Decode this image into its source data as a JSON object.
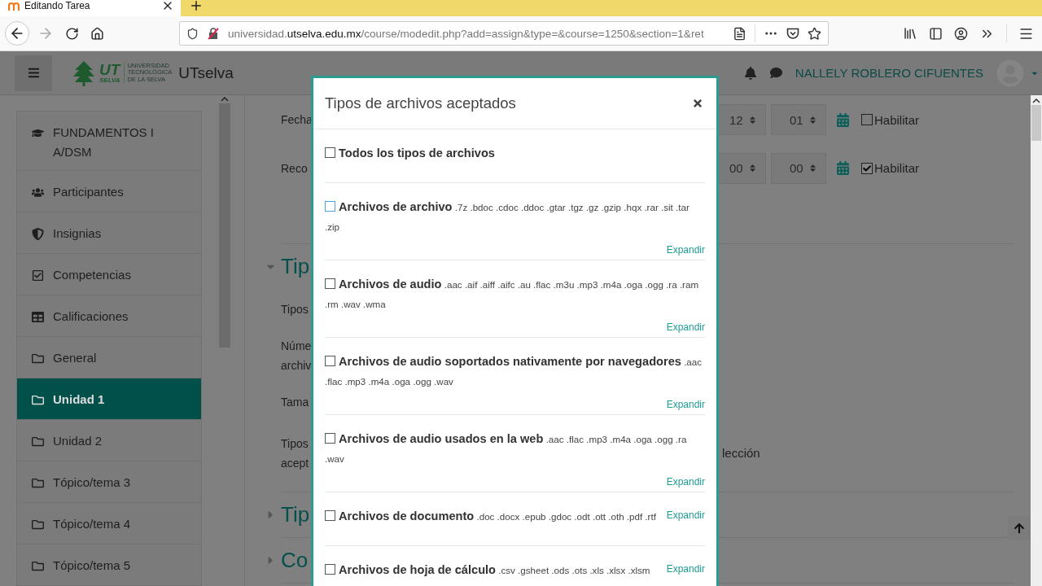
{
  "browser": {
    "tab": {
      "title": "Editando Tarea"
    },
    "url": {
      "prefix": "universidad.",
      "host": "utselva.edu.mx",
      "path": "/course/modedit.php?add=assign&type=&course=1250&section=1&ret"
    }
  },
  "header": {
    "logo": {
      "mark": "UT",
      "sub": "SELVA",
      "lines": [
        "UNIVERSIDAD",
        "TECNOLÓGICA",
        "DE LA SELVA"
      ]
    },
    "site_name": "UTselva",
    "user_name": "NALLELY ROBLERO CIFUENTES"
  },
  "sidebar": {
    "items": [
      {
        "label": "FUNDAMENTOS I A/DSM",
        "kind": "course",
        "selected": false
      },
      {
        "label": "Participantes",
        "kind": "users",
        "selected": false
      },
      {
        "label": "Insignias",
        "kind": "badges",
        "selected": false
      },
      {
        "label": "Competencias",
        "kind": "competencies",
        "selected": false
      },
      {
        "label": "Calificaciones",
        "kind": "grades",
        "selected": false
      },
      {
        "label": "General",
        "kind": "section",
        "selected": false
      },
      {
        "label": "Unidad 1",
        "kind": "section",
        "selected": true
      },
      {
        "label": "Unidad 2",
        "kind": "section",
        "selected": false
      },
      {
        "label": "Tópico/tema 3",
        "kind": "section",
        "selected": false
      },
      {
        "label": "Tópico/tema 4",
        "kind": "section",
        "selected": false
      },
      {
        "label": "Tópico/tema 5",
        "kind": "section",
        "selected": false
      }
    ]
  },
  "main": {
    "rows": [
      {
        "kind": "date",
        "lines": [
          "Fecha"
        ],
        "selects": [
          "12",
          "01"
        ],
        "enable_label": "Habilitar",
        "checked": false
      },
      {
        "kind": "date",
        "lines": [
          "Reco"
        ],
        "selects": [
          "00",
          "00"
        ],
        "enable_label": "Habilitar",
        "checked": true
      },
      {
        "kind": "section",
        "lines": [
          "Tip"
        ],
        "expanded": true
      },
      {
        "kind": "field",
        "lines": [
          "Tipos"
        ]
      },
      {
        "kind": "field",
        "lines": [
          "Núme",
          "archiv"
        ]
      },
      {
        "kind": "field",
        "lines": [
          "Tama"
        ]
      },
      {
        "kind": "field",
        "lines": [
          "Tipos",
          "acept"
        ],
        "trailing": "lección"
      },
      {
        "kind": "section",
        "lines": [
          "Tip"
        ],
        "expanded": false
      },
      {
        "kind": "section",
        "lines": [
          "Co"
        ],
        "expanded": false
      }
    ]
  },
  "modal": {
    "title": "Tipos de archivos aceptados",
    "items": [
      {
        "label": "Todos los tipos de archivos",
        "focused": false,
        "checked": false
      },
      {
        "label": "Archivos de archivo",
        "extensions": ".7z .bdoc .cdoc .ddoc .gtar .tgz .gz .gzip .hqx .rar .sit .tar .zip",
        "expand": "Expandir",
        "focused": true,
        "checked": false
      },
      {
        "label": "Archivos de audio",
        "extensions": ".aac .aif .aiff .aifc .au .flac .m3u .mp3 .m4a .oga .ogg .ra .ram .rm .wav .wma",
        "expand": "Expandir",
        "focused": false,
        "checked": false
      },
      {
        "label": "Archivos de audio soportados nativamente por navegadores",
        "extensions": ".aac .flac .mp3 .m4a .oga .ogg .wav",
        "expand": "Expandir",
        "focused": false,
        "checked": false
      },
      {
        "label": "Archivos de audio usados en la web",
        "extensions": ".aac .flac .mp3 .m4a .oga .ogg .ra .wav",
        "expand": "Expandir",
        "focused": false,
        "checked": false
      },
      {
        "label": "Archivos de documento",
        "extensions": ".doc .docx .epub .gdoc .odt .ott .oth .pdf .rtf",
        "expand": "Expandir",
        "focused": false,
        "checked": false
      },
      {
        "label": "Archivos de hoja de cálculo",
        "extensions": ".csv .gsheet .ods .ots .xls .xlsx .xlsm",
        "expand": "Expandir",
        "focused": false,
        "checked": false
      }
    ]
  }
}
